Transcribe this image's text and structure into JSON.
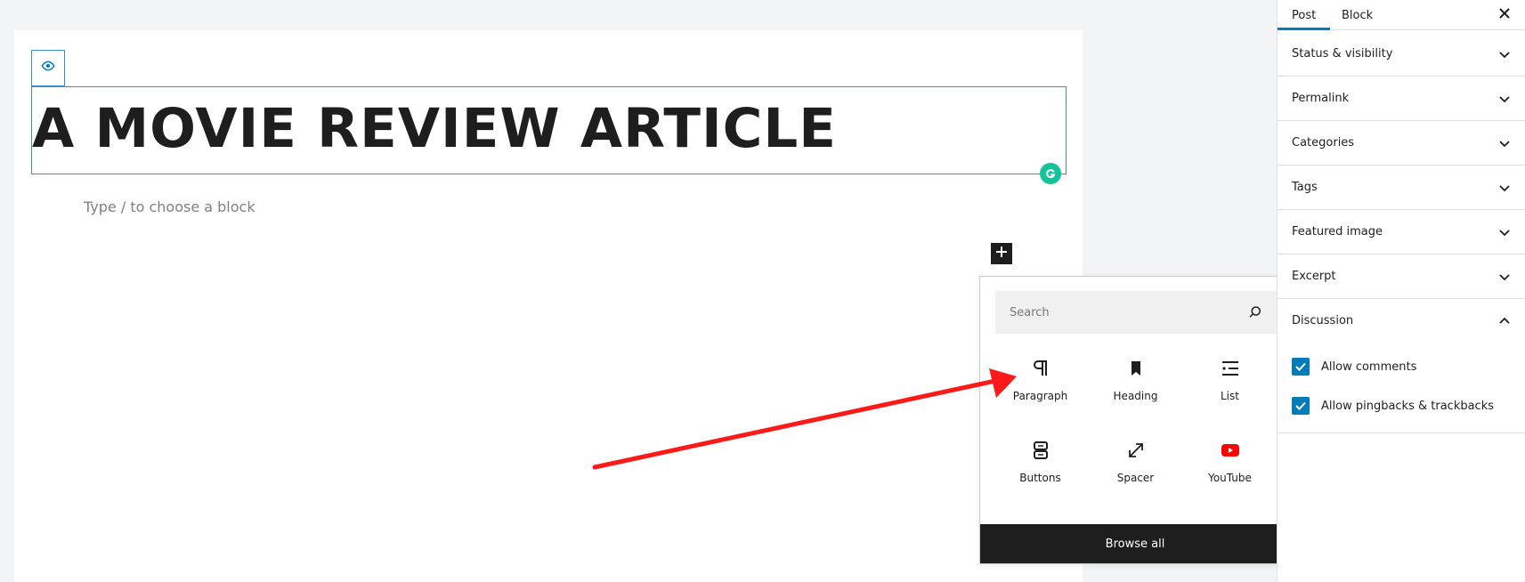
{
  "editor": {
    "title": "A MOVIE REVIEW ARTICLE",
    "block_placeholder": "Type / to choose a block"
  },
  "inserter": {
    "search_placeholder": "Search",
    "blocks": [
      {
        "label": "Paragraph",
        "icon": "paragraph-icon"
      },
      {
        "label": "Heading",
        "icon": "heading-icon"
      },
      {
        "label": "List",
        "icon": "list-icon"
      },
      {
        "label": "Buttons",
        "icon": "buttons-icon"
      },
      {
        "label": "Spacer",
        "icon": "spacer-icon"
      },
      {
        "label": "YouTube",
        "icon": "youtube-icon"
      }
    ],
    "browse_all": "Browse all"
  },
  "sidebar": {
    "tabs": [
      "Post",
      "Block"
    ],
    "active_tab": "Post",
    "panels": [
      {
        "title": "Status & visibility",
        "expanded": false
      },
      {
        "title": "Permalink",
        "expanded": false
      },
      {
        "title": "Categories",
        "expanded": false
      },
      {
        "title": "Tags",
        "expanded": false
      },
      {
        "title": "Featured image",
        "expanded": false
      },
      {
        "title": "Excerpt",
        "expanded": false
      },
      {
        "title": "Discussion",
        "expanded": true
      }
    ],
    "discussion": {
      "allow_comments": {
        "label": "Allow comments",
        "checked": true
      },
      "allow_pingbacks": {
        "label": "Allow pingbacks & trackbacks",
        "checked": true
      }
    }
  },
  "colors": {
    "accent": "#007cba",
    "selection_border": "#3c8fcf",
    "grammarly": "#15c39a",
    "annotation_arrow": "#ff1a1a",
    "youtube": "#ff0000"
  }
}
